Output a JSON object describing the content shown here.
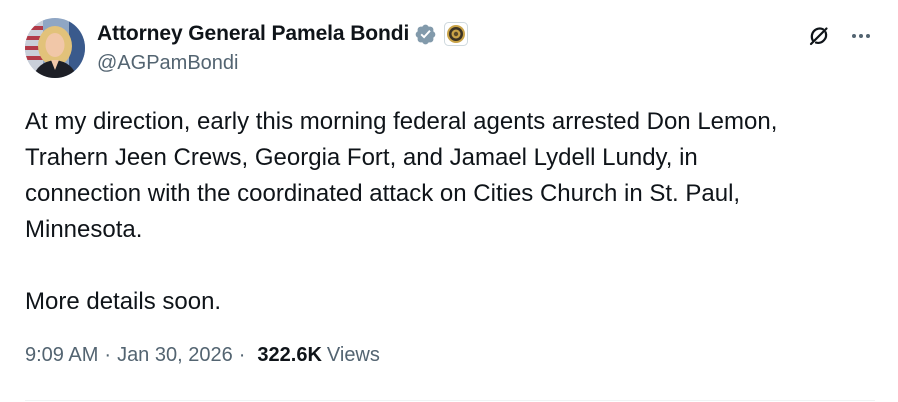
{
  "author": {
    "display_name": "Attorney General Pamela Bondi",
    "handle": "@AGPamBondi",
    "verified_badge_icon": "verified-badge-gray",
    "affiliate_badge_icon": "doj-seal",
    "avatar_icon": "profile-photo"
  },
  "tweet": {
    "text": "At my direction, early this morning federal agents arrested Don Lemon,\nTrahern Jeen Crews, Georgia Fort, and Jamael Lydell Lundy, in\nconnection with the coordinated attack on Cities Church in St. Paul,\nMinnesota.\n\nMore details soon."
  },
  "meta": {
    "time": "9:09 AM",
    "separator": "·",
    "date": "Jan 30, 2026",
    "views_count": "322.6K",
    "views_label": "Views"
  },
  "icons": {
    "grok": "grok-icon",
    "more": "more-options-icon"
  },
  "colors": {
    "text_primary": "#0f1419",
    "text_secondary": "#536471",
    "verified_badge": "#829aab",
    "divider": "#eff3f4"
  }
}
